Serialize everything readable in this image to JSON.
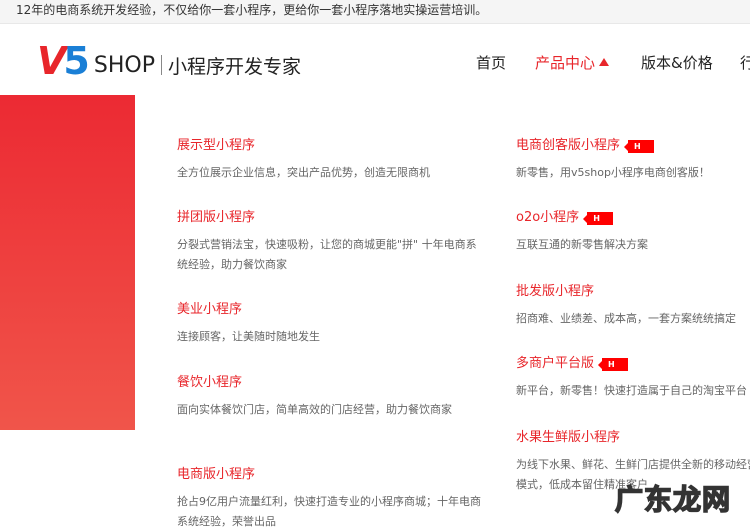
{
  "topbar": {
    "text": "12年的电商系统开发经验，不仅给你一套小程序，更给你一套小程序落地实操运营培训。"
  },
  "header": {
    "logo_v": "V",
    "logo_5": "5",
    "logo_shop": "SHOP",
    "slogan": "小程序开发专家",
    "nav": [
      {
        "label": "首页"
      },
      {
        "label": "产品中心"
      },
      {
        "label": "版本&价格"
      },
      {
        "label": "行"
      }
    ]
  },
  "colors": {
    "accent": "#e8262b",
    "logo_blue": "#1a7fd6"
  },
  "products_left": [
    {
      "title": "展示型小程序",
      "desc": "全方位展示企业信息，突出产品优势，创造无限商机"
    },
    {
      "title": "拼团版小程序",
      "desc": "分裂式营销法宝，快速吸粉，让您的商城更能\"拼\" 十年电商系统经验，助力餐饮商家"
    },
    {
      "title": "美业小程序",
      "desc": "连接顾客，让美随时随地发生"
    },
    {
      "title": "餐饮小程序",
      "desc": "面向实体餐饮门店，简单高效的门店经营，助力餐饮商家"
    },
    {
      "title": "电商版小程序",
      "desc": "抢占9亿用户流量红利，快速打造专业的小程序商城；十年电商系统经验，荣誉出品"
    }
  ],
  "products_right": [
    {
      "title": "电商创客版小程序",
      "badge": "H",
      "desc": "新零售，用v5shop小程序电商创客版！"
    },
    {
      "title": "o2o小程序",
      "badge": "H",
      "desc": "互联互通的新零售解决方案"
    },
    {
      "title": "批发版小程序",
      "desc": "招商难、业绩差、成本高，一套方案统统搞定"
    },
    {
      "title": "多商户平台版",
      "badge": "H",
      "desc": "新平台，新零售！快速打造属于自己的淘宝平台"
    },
    {
      "title": "水果生鲜版小程序",
      "desc": "为线下水果、鲜花、生鲜门店提供全新的移动经营模式，低成本留住精准客户"
    }
  ],
  "watermark": "广东龙网"
}
